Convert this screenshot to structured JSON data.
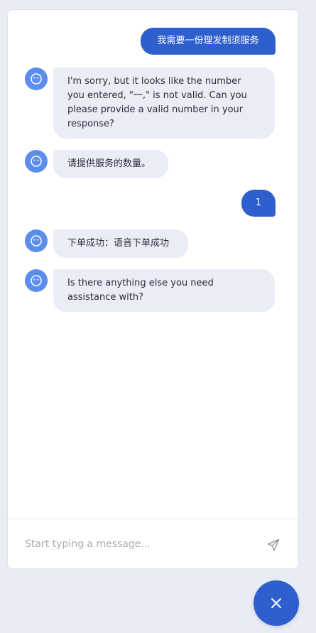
{
  "messages": [
    {
      "sender": "user",
      "text": "我需要一份理发制须服务"
    },
    {
      "sender": "bot",
      "text": "I'm sorry, but it looks like the number\nyou entered, \"一,\" is not valid. Can you\nplease provide a valid number in your\nresponse?"
    },
    {
      "sender": "bot",
      "text": "请提供服务的数量。"
    },
    {
      "sender": "user",
      "text": "1"
    },
    {
      "sender": "bot",
      "text": "下单成功：语音下单成功"
    },
    {
      "sender": "bot",
      "text": "Is there anything else you need\nassistance with?"
    }
  ],
  "composer": {
    "placeholder": "Start typing a message...",
    "value": ""
  },
  "icons": {
    "bot_avatar": "smiley-face-icon",
    "send": "paper-plane-icon",
    "close": "close-icon"
  },
  "colors": {
    "accent": "#2f5fcc",
    "bot_avatar": "#5b8def",
    "bot_bubble": "#eaecf6",
    "page_background": "#e9ebf5"
  }
}
